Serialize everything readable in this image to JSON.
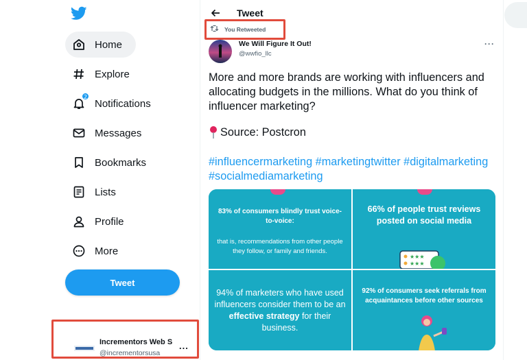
{
  "colors": {
    "brand": "#1d9bf0",
    "highlight_box": "#e14b3c",
    "infographic_bg": "#19aac3",
    "accent_pink": "#e84b8a"
  },
  "sidebar": {
    "logo_icon": "twitter-bird-icon",
    "items": [
      {
        "label": "Home",
        "icon": "home-icon",
        "active": true
      },
      {
        "label": "Explore",
        "icon": "hashtag-icon"
      },
      {
        "label": "Notifications",
        "icon": "bell-icon",
        "badge": "2"
      },
      {
        "label": "Messages",
        "icon": "envelope-icon"
      },
      {
        "label": "Bookmarks",
        "icon": "bookmark-icon"
      },
      {
        "label": "Lists",
        "icon": "list-icon"
      },
      {
        "label": "Profile",
        "icon": "person-icon"
      },
      {
        "label": "More",
        "icon": "more-circle-icon"
      }
    ],
    "tweet_button_label": "Tweet",
    "account": {
      "name": "Incrementors Web S",
      "handle": "@incrementorsusa",
      "more": "..."
    }
  },
  "header": {
    "title": "Tweet",
    "back_icon": "arrow-left-icon"
  },
  "tweet": {
    "retweet_label": "You Retweeted",
    "author_name": "We Will Figure It Out!",
    "author_handle": "@wwfio_llc",
    "more": "···",
    "body": "More and more brands are working with influencers and allocating budgets in the millions. What do you think of influencer marketing?",
    "source": "Source: Postcron",
    "hashtags": [
      "#influencermarketing",
      "#marketingtwitter",
      "#digitalmarketing",
      "#socialmediamarketing"
    ]
  },
  "infographic": {
    "cell1_title": "83% of consumers blindly trust voice-to-voice:",
    "cell1_body": "that is, recommendations from other people they follow, or family and friends.",
    "cell2_title": "66% of people trust reviews posted on social media",
    "cell3_pre": "94% of marketers who have used influencers consider them to be an ",
    "cell3_bold": "effective strategy",
    "cell3_post": " for their business.",
    "cell4_title": "92% of consumers seek referrals from acquaintances before other sources"
  }
}
